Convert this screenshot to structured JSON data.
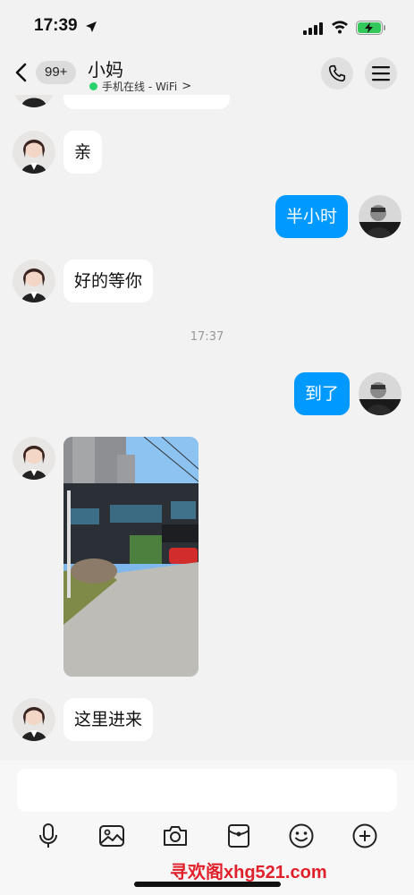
{
  "status_bar": {
    "time": "17:39"
  },
  "header": {
    "unread_count": "99+",
    "contact_name": "小妈",
    "online_status": "手机在线 - WiFi",
    "online_chevron": ">"
  },
  "messages": {
    "m1": "亲",
    "m2": "半小时",
    "m3": "好的等你",
    "time_sep": "17:37",
    "m4": "到了",
    "m6": "这里进来"
  },
  "input": {
    "placeholder": ""
  },
  "toolbar": {
    "icons": [
      "mic-icon",
      "image-icon",
      "camera-icon",
      "red-packet-icon",
      "emoji-icon",
      "plus-icon"
    ]
  },
  "watermark": "寻欢阁xhg521.com",
  "colors": {
    "accent": "#0099ff",
    "online": "#2ad26a",
    "background": "#f2f2f2"
  }
}
